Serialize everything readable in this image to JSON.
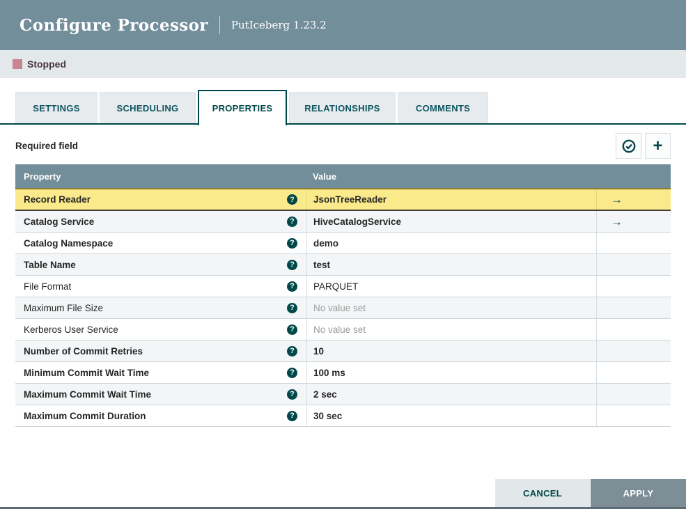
{
  "dialog": {
    "title": "Configure Processor",
    "subtitle": "PutIceberg 1.23.2",
    "status": {
      "label": "Stopped",
      "color": "#C9858D"
    }
  },
  "tabs": [
    {
      "label": "SETTINGS",
      "active": false
    },
    {
      "label": "SCHEDULING",
      "active": false
    },
    {
      "label": "PROPERTIES",
      "active": true
    },
    {
      "label": "RELATIONSHIPS",
      "active": false
    },
    {
      "label": "COMMENTS",
      "active": false
    }
  ],
  "toolbar": {
    "required_label": "Required field",
    "buttons": [
      {
        "icon": "verify-properties-icon"
      },
      {
        "icon": "add-property-icon"
      }
    ]
  },
  "icons": {
    "help_glyph": "?",
    "goto_glyph": "→",
    "add_glyph": "+",
    "verify": "check-circle"
  },
  "table": {
    "columns": {
      "property": "Property",
      "value": "Value"
    },
    "rows": [
      {
        "property": "Record Reader",
        "value": "JsonTreeReader",
        "required": true,
        "selected": true,
        "placeholder": false,
        "has_link": true
      },
      {
        "property": "Catalog Service",
        "value": "HiveCatalogService",
        "required": true,
        "selected": false,
        "placeholder": false,
        "has_link": true
      },
      {
        "property": "Catalog Namespace",
        "value": "demo",
        "required": true,
        "selected": false,
        "placeholder": false,
        "has_link": false
      },
      {
        "property": "Table Name",
        "value": "test",
        "required": true,
        "selected": false,
        "placeholder": false,
        "has_link": false
      },
      {
        "property": "File Format",
        "value": "PARQUET",
        "required": false,
        "selected": false,
        "placeholder": false,
        "has_link": false
      },
      {
        "property": "Maximum File Size",
        "value": "No value set",
        "required": false,
        "selected": false,
        "placeholder": true,
        "has_link": false
      },
      {
        "property": "Kerberos User Service",
        "value": "No value set",
        "required": false,
        "selected": false,
        "placeholder": true,
        "has_link": false
      },
      {
        "property": "Number of Commit Retries",
        "value": "10",
        "required": true,
        "selected": false,
        "placeholder": false,
        "has_link": false
      },
      {
        "property": "Minimum Commit Wait Time",
        "value": "100 ms",
        "required": true,
        "selected": false,
        "placeholder": false,
        "has_link": false
      },
      {
        "property": "Maximum Commit Wait Time",
        "value": "2 sec",
        "required": true,
        "selected": false,
        "placeholder": false,
        "has_link": false
      },
      {
        "property": "Maximum Commit Duration",
        "value": "30 sec",
        "required": true,
        "selected": false,
        "placeholder": false,
        "has_link": false
      }
    ]
  },
  "footer": {
    "cancel_label": "CANCEL",
    "apply_label": "APPLY"
  },
  "colors": {
    "header_bg": "#728E9B",
    "accent_teal": "#004849",
    "selected_row_bg": "#FBEA8B",
    "status_bar_bg": "#E3E8EB",
    "apply_button_bg": "#7D8E97"
  }
}
